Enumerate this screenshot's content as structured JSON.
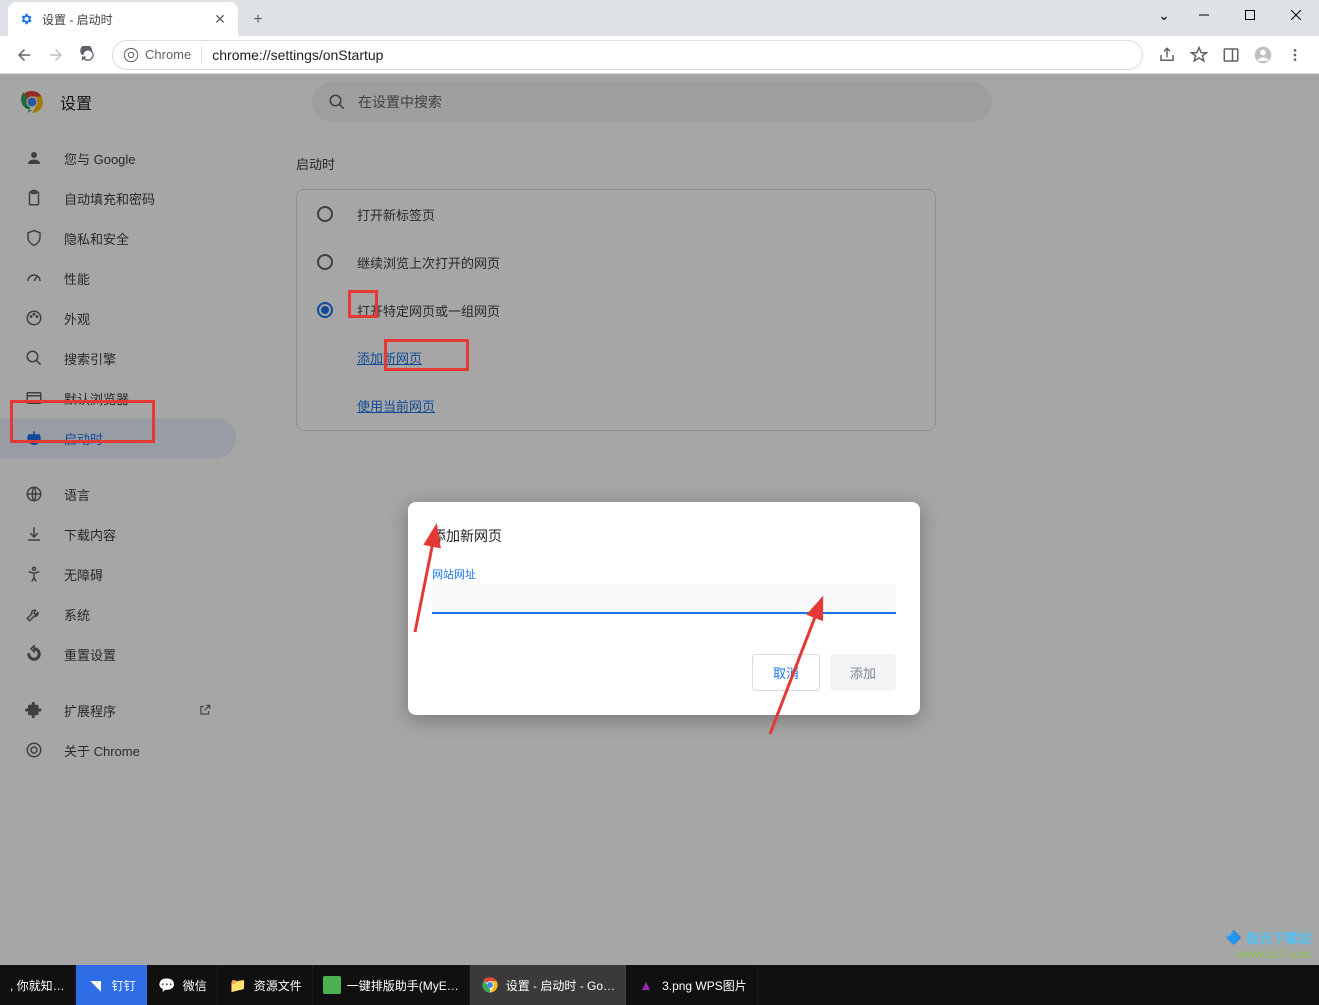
{
  "window": {
    "tab_title": "设置 - 启动时"
  },
  "toolbar": {
    "site_chip": "Chrome",
    "url": "chrome://settings/onStartup"
  },
  "settings": {
    "title": "设置",
    "search_placeholder": "在设置中搜索"
  },
  "sidebar": {
    "items": [
      {
        "label": "您与 Google"
      },
      {
        "label": "自动填充和密码"
      },
      {
        "label": "隐私和安全"
      },
      {
        "label": "性能"
      },
      {
        "label": "外观"
      },
      {
        "label": "搜索引擎"
      },
      {
        "label": "默认浏览器"
      },
      {
        "label": "启动时"
      }
    ],
    "items2": [
      {
        "label": "语言"
      },
      {
        "label": "下载内容"
      },
      {
        "label": "无障碍"
      },
      {
        "label": "系统"
      },
      {
        "label": "重置设置"
      }
    ],
    "items3": [
      {
        "label": "扩展程序"
      },
      {
        "label": "关于 Chrome"
      }
    ]
  },
  "main": {
    "section_title": "启动时",
    "radios": [
      {
        "label": "打开新标签页"
      },
      {
        "label": "继续浏览上次打开的网页"
      },
      {
        "label": "打开特定网页或一组网页"
      }
    ],
    "links": {
      "add_new": "添加新网页",
      "use_current": "使用当前网页"
    }
  },
  "dialog": {
    "title": "添加新网页",
    "field_label": "网站网址",
    "field_value": "",
    "cancel": "取消",
    "add": "添加"
  },
  "taskbar": {
    "start": ", 你就知…",
    "items": [
      {
        "label": "钉钉"
      },
      {
        "label": "微信"
      },
      {
        "label": "资源文件"
      },
      {
        "label": "一键排版助手(MyE…"
      },
      {
        "label": "设置 - 启动时 - Go…"
      },
      {
        "label": "3.png  WPS图片"
      }
    ]
  },
  "watermark": {
    "brand": "极光下载站",
    "url": "www.xz7.com"
  }
}
